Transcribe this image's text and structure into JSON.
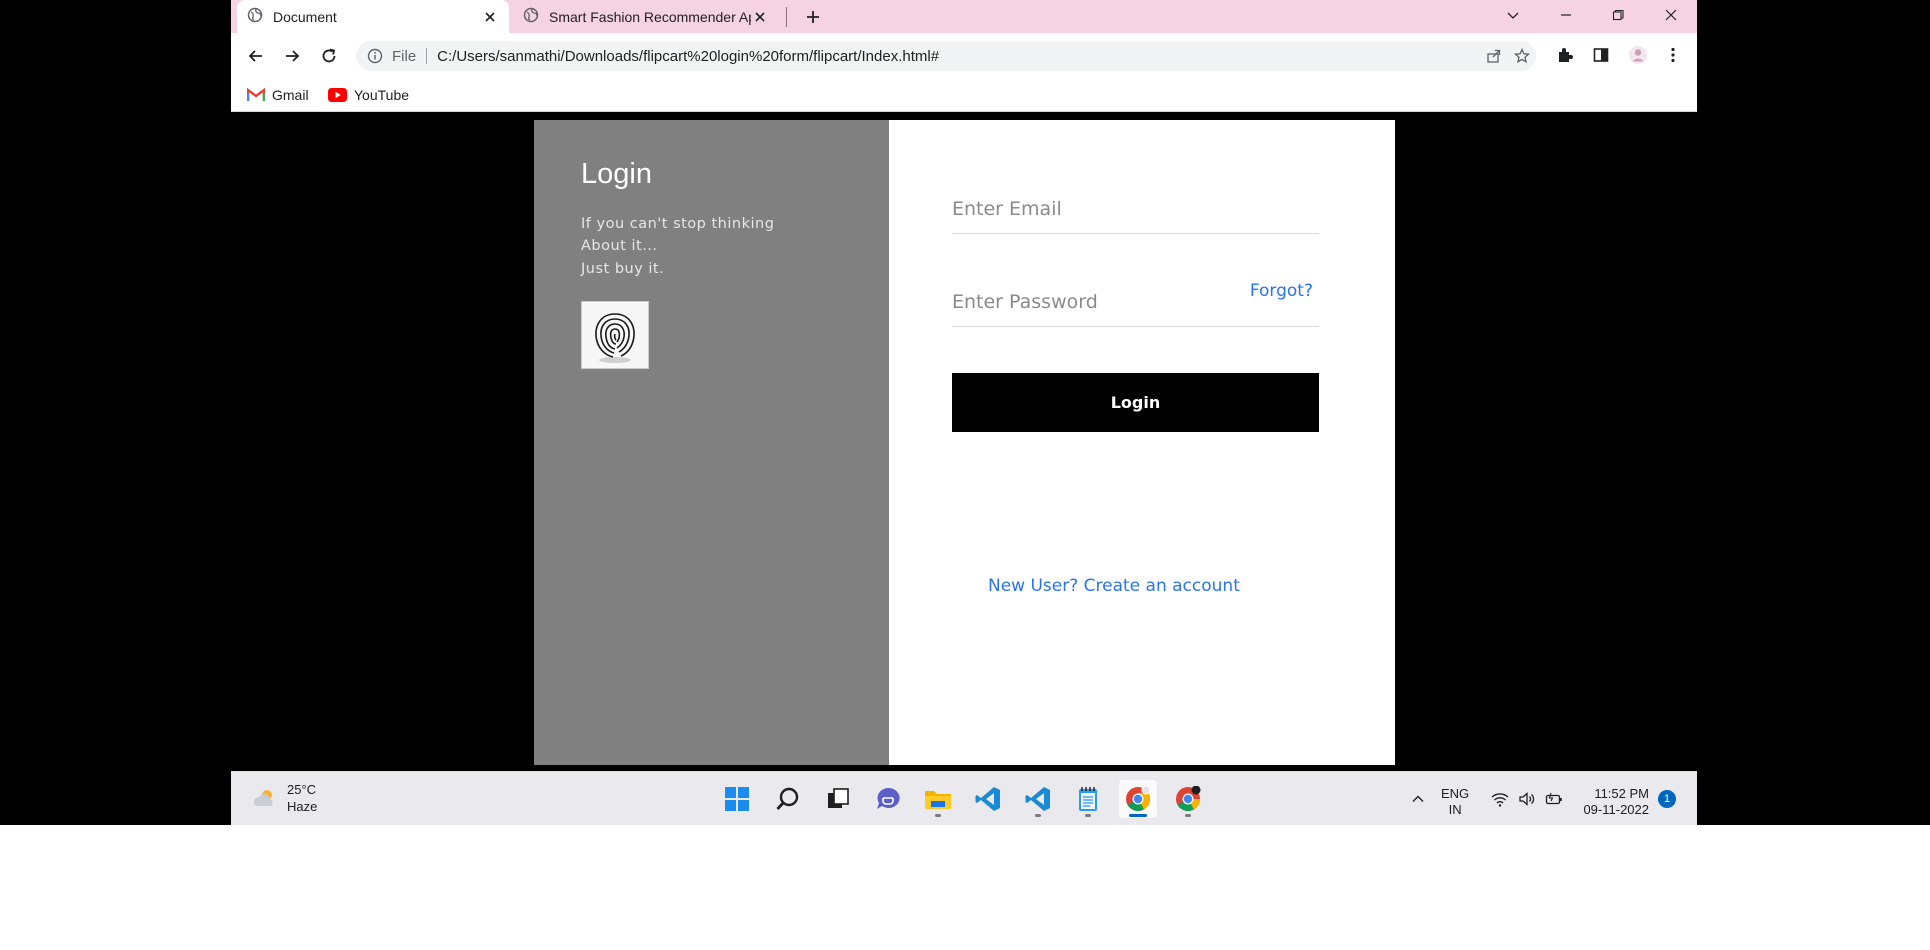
{
  "browser": {
    "tabs": [
      {
        "title": "Document",
        "active": true
      },
      {
        "title": "Smart Fashion Recommender Ap",
        "active": false
      }
    ],
    "address": {
      "scheme": "File",
      "url": "C:/Users/sanmathi/Downloads/flipcart%20login%20form/flipcart/Index.html#"
    },
    "bookmarks": [
      {
        "label": "Gmail",
        "icon": "gmail-icon"
      },
      {
        "label": "YouTube",
        "icon": "youtube-icon"
      }
    ]
  },
  "page": {
    "left_panel": {
      "title": "Login",
      "tagline": [
        "If you can't stop thinking",
        "About it...",
        "Just buy it."
      ],
      "image": "fingerprint-icon"
    },
    "form": {
      "email_placeholder": "Enter Email",
      "password_placeholder": "Enter Password",
      "forgot_label": "Forgot?",
      "login_button": "Login",
      "signup_link": "New User? Create an account"
    },
    "colors": {
      "panel_gray": "#808080",
      "link_blue": "#2874f0",
      "button_black": "#000000"
    }
  },
  "taskbar": {
    "weather": {
      "temp": "25°C",
      "condition": "Haze"
    },
    "language": {
      "line1": "ENG",
      "line2": "IN"
    },
    "clock": {
      "time": "11:52 PM",
      "date": "09-11-2022"
    },
    "notification_count": "1"
  }
}
